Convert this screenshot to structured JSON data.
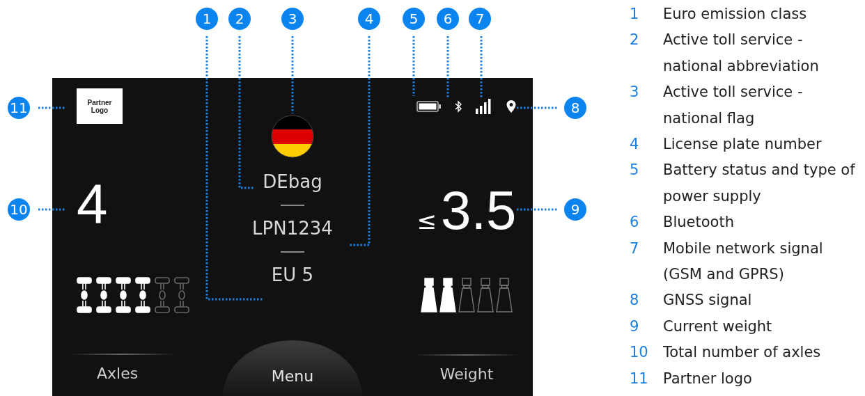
{
  "callouts": [
    {
      "number": "1"
    },
    {
      "number": "2"
    },
    {
      "number": "3"
    },
    {
      "number": "4"
    },
    {
      "number": "5"
    },
    {
      "number": "6"
    },
    {
      "number": "7"
    },
    {
      "number": "8"
    },
    {
      "number": "9"
    },
    {
      "number": "10"
    },
    {
      "number": "11"
    }
  ],
  "screen": {
    "partner_logo": "Partner Logo",
    "toll_service": "DEbag",
    "license_plate": "LPN1234",
    "emission_class": "EU 5",
    "axle_count": "4",
    "weight_prefix": "≤",
    "weight": "3.5",
    "axles": [
      {
        "active": true
      },
      {
        "active": true
      },
      {
        "active": true
      },
      {
        "active": true
      },
      {
        "active": false
      },
      {
        "active": false
      }
    ],
    "weight_classes": [
      {
        "active": true
      },
      {
        "active": true
      },
      {
        "active": false
      },
      {
        "active": false
      },
      {
        "active": false
      }
    ],
    "buttons": [
      {
        "label": "Axles"
      },
      {
        "label": "Menu"
      },
      {
        "label": "Weight"
      }
    ]
  },
  "legend": [
    {
      "number": "1",
      "text": "Euro emission class"
    },
    {
      "number": "2",
      "text": "Active toll service - national abbreviation"
    },
    {
      "number": "3",
      "text": "Active toll service - national flag"
    },
    {
      "number": "4",
      "text": "License plate number"
    },
    {
      "number": "5",
      "text": "Battery status and type of power supply"
    },
    {
      "number": "6",
      "text": "Bluetooth"
    },
    {
      "number": "7",
      "text": "Mobile network signal (GSM and GPRS)"
    },
    {
      "number": "8",
      "text": "GNSS signal"
    },
    {
      "number": "9",
      "text": "Current weight"
    },
    {
      "number": "10",
      "text": "Total number of axles"
    },
    {
      "number": "11",
      "text": "Partner logo"
    }
  ]
}
